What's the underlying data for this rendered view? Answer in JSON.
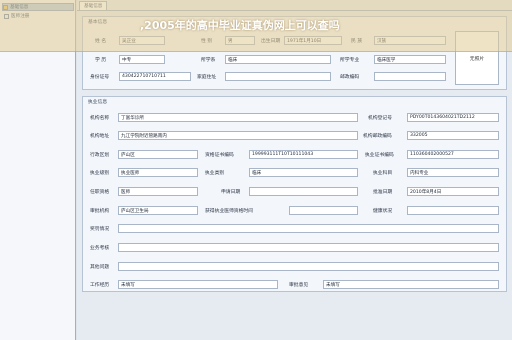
{
  "overlay_text": ",2005年的高中毕业证真伪网上可以查吗",
  "sidebar": {
    "items": [
      {
        "label": "基础信息",
        "icon": "folder-icon"
      },
      {
        "label": "医师注册",
        "icon": "document-icon"
      }
    ]
  },
  "tab": {
    "label": "基础信息"
  },
  "basic": {
    "title": "基本信息",
    "name_label": "姓  名",
    "name_value": "吴正业",
    "sex_label": "性  别",
    "sex_value": "男",
    "birth_label": "出生日期",
    "birth_value": "1971年1月10日",
    "nation_label": "民  族",
    "nation_value": "汉族",
    "edu_label": "学  历",
    "edu_value": "中专",
    "dept_label": "所学系",
    "dept_value": "临床",
    "major_label": "所学专业",
    "major_value": "临床医学",
    "id_label": "身份证号",
    "id_value": "430422710710711",
    "addr_label": "家庭住址",
    "addr_value": "",
    "zip_label": "邮政编码",
    "zip_value": "",
    "photo_label": "无照片"
  },
  "practice": {
    "title": "执业信息",
    "org_name_label": "机构名称",
    "org_name_value": "丁富华诊所",
    "org_reg_label": "机构登记号",
    "org_reg_value": "PDY00T0143604021TD2112",
    "org_addr_label": "机构地址",
    "org_addr_value": "九江学院附近管路南内",
    "org_zip_label": "机构邮政编码",
    "org_zip_value": "332005",
    "region_label": "行政区划",
    "region_value": "庐山区",
    "cert_label": "资格证书编码",
    "cert_value": "199993111T10T10111043",
    "license_label": "执业证书编码",
    "license_value": "110360402000527",
    "level_label": "执业级别",
    "level_value": "执业医师",
    "category_label": "执业类别",
    "category_value": "临床",
    "scope_label": "执业科目",
    "scope_value": "内科专业",
    "position_label": "任职资格",
    "position_value": "医师",
    "apply_date_label": "申请日期",
    "apply_date_value": "",
    "approve_date_label": "批准日期",
    "approve_date_value": "2010年8月4日",
    "authority_label": "审批机构",
    "authority_value": "庐山区卫生局",
    "obtain_label": "获得执业医师资格时间",
    "obtain_value": "",
    "health_label": "健康状况",
    "health_value": "",
    "award_label": "奖罚情况",
    "award_value": "",
    "assess_label": "业务考核",
    "assess_value": "",
    "other_label": "其他问题",
    "other_value": "",
    "work_label": "工作经历",
    "work_value": "未填写",
    "opinion_label": "审批意见",
    "opinion_value": "未填写"
  }
}
